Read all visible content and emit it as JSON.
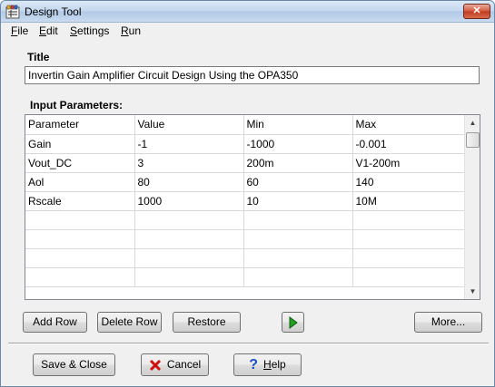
{
  "window": {
    "title": "Design Tool",
    "close_label": "✕"
  },
  "menu": {
    "items": [
      {
        "label": "File",
        "accel": "F",
        "rest": "ile"
      },
      {
        "label": "Edit",
        "accel": "E",
        "rest": "dit"
      },
      {
        "label": "Settings",
        "accel": "S",
        "rest": "ettings"
      },
      {
        "label": "Run",
        "accel": "R",
        "rest": "un"
      }
    ]
  },
  "title_section": {
    "label": "Title",
    "value": "Invertin Gain Amplifier Circuit Design Using the OPA350"
  },
  "params": {
    "label": "Input Parameters:",
    "columns": [
      "Parameter",
      "Value",
      "Min",
      "Max"
    ],
    "rows": [
      [
        "Gain",
        "-1",
        "-1000",
        "-0.001"
      ],
      [
        "Vout_DC",
        "3",
        "200m",
        "V1-200m"
      ],
      [
        "Aol",
        "80",
        "60",
        "140"
      ],
      [
        "Rscale",
        "1000",
        "10",
        "10M"
      ],
      [
        "",
        "",
        "",
        ""
      ],
      [
        "",
        "",
        "",
        ""
      ],
      [
        "",
        "",
        "",
        ""
      ],
      [
        "",
        "",
        "",
        ""
      ]
    ]
  },
  "buttons": {
    "add_row": "Add Row",
    "delete_row": "Delete Row",
    "restore": "Restore",
    "more": "More...",
    "save_close": "Save & Close",
    "cancel": "Cancel",
    "help": "Help"
  },
  "colors": {
    "play_green": "#22a022",
    "cancel_red": "#cc1111",
    "help_blue": "#1c4fc4"
  }
}
